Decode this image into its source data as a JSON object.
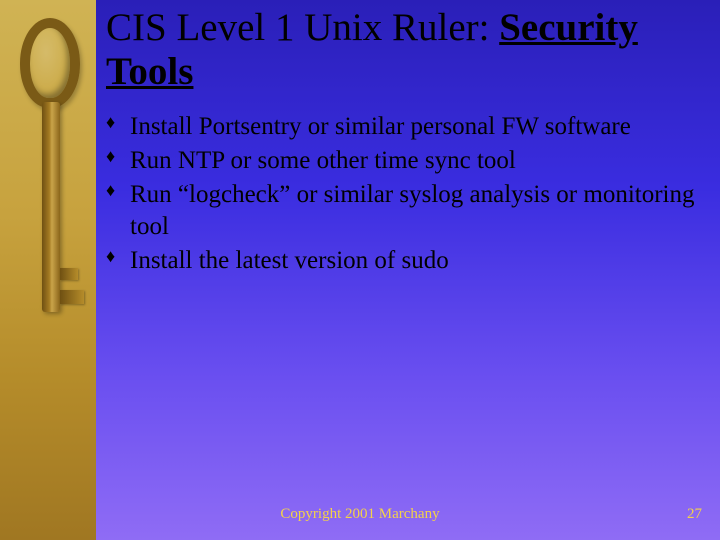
{
  "title_prefix": "CIS Level 1 Unix Ruler: ",
  "title_underlined": "Security Tools",
  "bullets": [
    "Install Portsentry or similar personal FW software",
    "Run NTP or some other time sync tool",
    "Run “logcheck” or similar syslog analysis or monitoring tool",
    "Install the latest version of sudo"
  ],
  "footer": {
    "copyright": "Copyright 2001 Marchany",
    "page_number": "27"
  },
  "colors": {
    "sidebar_gold": "#c7a23e",
    "bg_gradient_top": "#2a1fb8",
    "bg_gradient_bottom": "#8f6cf5",
    "footer_text": "#f3d24a"
  }
}
